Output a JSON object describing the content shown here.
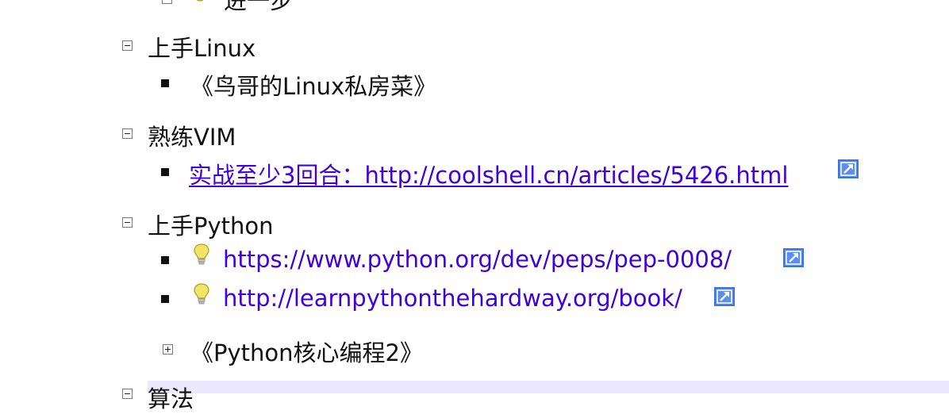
{
  "sections": [
    {
      "title": "上手Linux",
      "items": [
        {
          "text": "《鸟哥的Linux私房菜》"
        }
      ]
    },
    {
      "title": "熟练VIM",
      "items": [
        {
          "link": "实战至少3回合：http://coolshell.cn/articles/5426.html"
        }
      ]
    },
    {
      "title": "上手Python",
      "items": [
        {
          "link": "https://www.python.org/dev/peps/pep-0008/"
        },
        {
          "link": "http://learnpythonthehardway.org/book/"
        }
      ],
      "collapsed_child": "《Python核心编程2》"
    }
  ],
  "top_partial": "进一步",
  "bottom_partial": "算法",
  "colors": {
    "link": "#3f00e0",
    "highlight": "#ece9ff",
    "external_icon": "#5a8ef5"
  },
  "icons": {
    "expanded": "minus-box-icon",
    "collapsed": "plus-box-icon",
    "bullet": "square-bullet",
    "hint": "lightbulb-icon",
    "external": "external-link-icon"
  }
}
